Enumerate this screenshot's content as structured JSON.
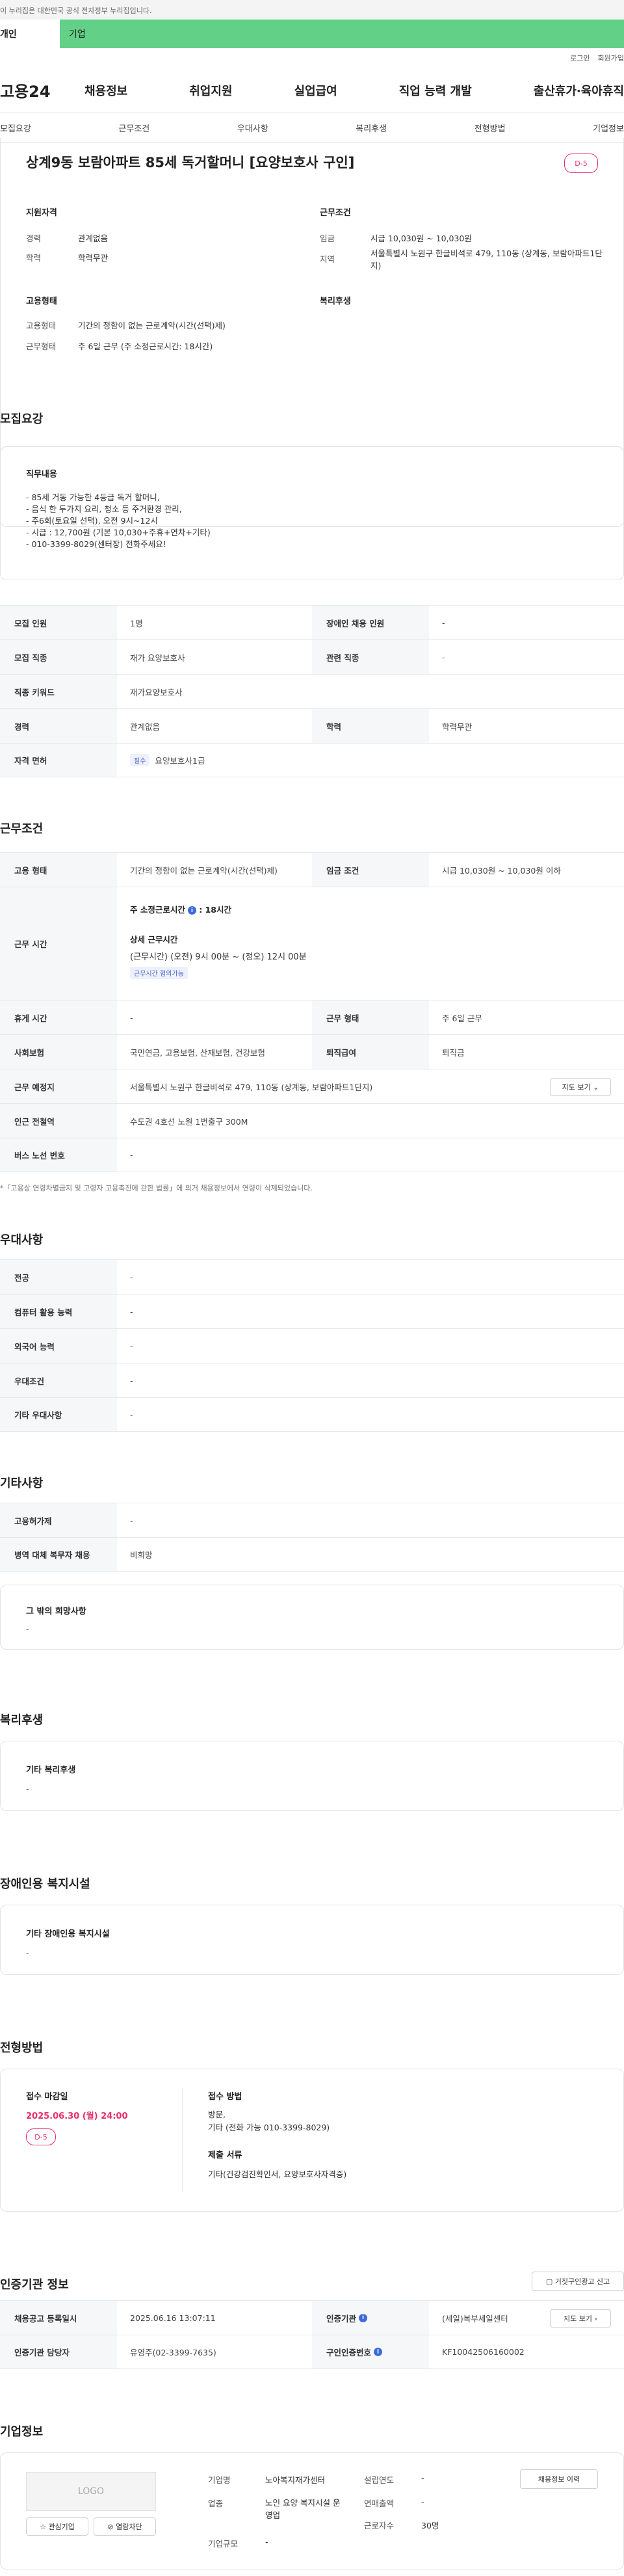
{
  "top_notice": "이 누리집은 대한민국 공식 전자정부 누리집입니다.",
  "user_tabs": [
    "개인",
    "기업"
  ],
  "util_links": [
    "로그인",
    "회원가입"
  ],
  "logo": "고용24",
  "gnb": [
    "채용정보",
    "취업지원",
    "실업급여",
    "직업 능력 개발",
    "출산휴가·육아휴직"
  ],
  "subtabs": [
    "모집요강",
    "근무조건",
    "우대사항",
    "복리후생",
    "전형방법",
    "기업정보"
  ],
  "job": {
    "title": "상계9동 보람아파트 85세 독거할머니 [요양보호사 구인]",
    "dday": "D-5",
    "qual_title": "지원자격",
    "exp_label": "경력",
    "exp_val": "관계없음",
    "edu_label": "학력",
    "edu_val": "학력무관",
    "cond_title": "근무조건",
    "wage_label": "임금",
    "wage_val": "시급 10,030원 ~ 10,030원",
    "loc_label": "지역",
    "loc_val": "서울특별시 노원구 한글비석로 479, 110동 (상계동, 보람아파트1단지)",
    "emp_title": "고용형태",
    "emp_label": "고용형태",
    "emp_val": "기간의 정함이 없는 근로계약(시간(선택)제)",
    "work_label": "근무형태",
    "work_val": "주 6일 근무 (주 소정근로시간: 18시간)",
    "welfare_title": "복리후생"
  },
  "recruit": {
    "title": "모집요강",
    "duty_title": "직무내용",
    "duty_lines": [
      "- 85세 거동 가능한 4등급 독거 할머니,",
      "- 음식 한 두가지 요리, 청소 등 주거환경 관리,",
      "- 주6회(토요일 선택), 오전 9시~12시",
      "- 시급 : 12,700원 (기본 10,030+주휴+연차+기타)",
      "- 010-3399-8029(센터장) 전화주세요!"
    ],
    "rows": [
      [
        "모집 인원",
        "1명",
        "장애인 채용 인원",
        "-"
      ],
      [
        "모집 직종",
        "재가 요양보호사",
        "관련 직종",
        "-"
      ],
      [
        "직종 키워드",
        "재가요양보호사"
      ],
      [
        "경력",
        "관계없음",
        "학력",
        "학력무관"
      ],
      [
        "자격 면허",
        "필수",
        "요양보호사1급"
      ]
    ]
  },
  "work": {
    "title": "근무조건",
    "r1": [
      "고용 형태",
      "기간의 정함이 없는 근로계약(시간(선택)제)",
      "임금 조건",
      "시급 10,030원 ~ 10,030원 이하"
    ],
    "hours_label": "근무 시간",
    "weekly": "주 소정근로시간",
    "weekly_val": ": 18시간",
    "detail_title": "상세 근무시간",
    "detail_val": "(근무시간) (오전) 9시 00분 ~ (정오) 12시 00분",
    "detail_tag": "근무시간 협의가능",
    "r3": [
      "휴게 시간",
      "-",
      "근무 형태",
      "주 6일 근무"
    ],
    "r4": [
      "사회보험",
      "국민연금, 고용보험, 산재보험, 건강보험",
      "퇴직급여",
      "퇴직금"
    ],
    "r5": [
      "근무 예정지",
      "서울특별시 노원구 한글비석로 479, 110동 (상계동, 보람아파트1단지)"
    ],
    "map_btn": "지도 보기",
    "r6": [
      "인근 전철역",
      "수도권 4호선 노원 1번출구 300M"
    ],
    "r7": [
      "버스 노선 번호",
      "-"
    ],
    "note": "*「고용상 연령차별금지 및 고령자 고용촉진에 관한 법률」에 의거 채용정보에서 연령이 삭제되었습니다."
  },
  "pref": {
    "title": "우대사항",
    "rows": [
      [
        "전공",
        "-"
      ],
      [
        "컴퓨터 활용 능력",
        "-"
      ],
      [
        "외국어 능력",
        "-"
      ],
      [
        "우대조건",
        "-"
      ],
      [
        "기타 우대사항",
        "-"
      ]
    ]
  },
  "etc": {
    "title": "기타사항",
    "rows": [
      [
        "고용허가제",
        "-"
      ],
      [
        "병역 대체 복무자 채용",
        "비희망"
      ]
    ],
    "box_title": "그 밖의 희망사항",
    "box_val": "-"
  },
  "welfare": {
    "title": "복리후생",
    "box_title": "기타 복리후생",
    "box_val": "-"
  },
  "disab": {
    "title": "장애인용 복지시설",
    "box_title": "기타 장애인용 복지시설",
    "box_val": "-"
  },
  "selection": {
    "title": "전형방법",
    "deadline_label": "접수 마감일",
    "deadline": "2025.06.30 (월) 24:00",
    "dday": "D-5",
    "method_label": "접수 방법",
    "method_val1": "방문,",
    "method_val2": "기타 (전화 가능 010-3399-8029)",
    "docs_label": "제출 서류",
    "docs_val": "기타(건강검진확인서, 요양보호사자격증)"
  },
  "agency": {
    "title": "인증기관 정보",
    "report_btn": "거짓구인광고 신고",
    "r1": [
      "채용공고 등록일시",
      "2025.06.16 13:07:11",
      "인증기관",
      "(세일)복부세일센터"
    ],
    "map_btn": "지도 보기",
    "r2": [
      "인증기관 담당자",
      "유영주(02-3399-7635)",
      "구인인증번호",
      "KF10042506160002"
    ]
  },
  "company": {
    "title": "기업정보",
    "logo": "LOGO",
    "fav_btn": "관심기업",
    "block_btn": "열람차단",
    "name_l": "기업명",
    "name_v": "노아복지재가센터",
    "ind_l": "업종",
    "ind_v": "노인 요양 복지시설 운영업",
    "size_l": "기업규모",
    "size_v": "-",
    "est_l": "설립연도",
    "est_v": "-",
    "sales_l": "연매출액",
    "sales_v": "-",
    "emp_l": "근로자수",
    "emp_v": "30명",
    "hist_btn": "채용정보 이력"
  },
  "colors": {
    "accent": "#63d088",
    "dday": "#e62e6a",
    "info": "#3d6ae0"
  }
}
